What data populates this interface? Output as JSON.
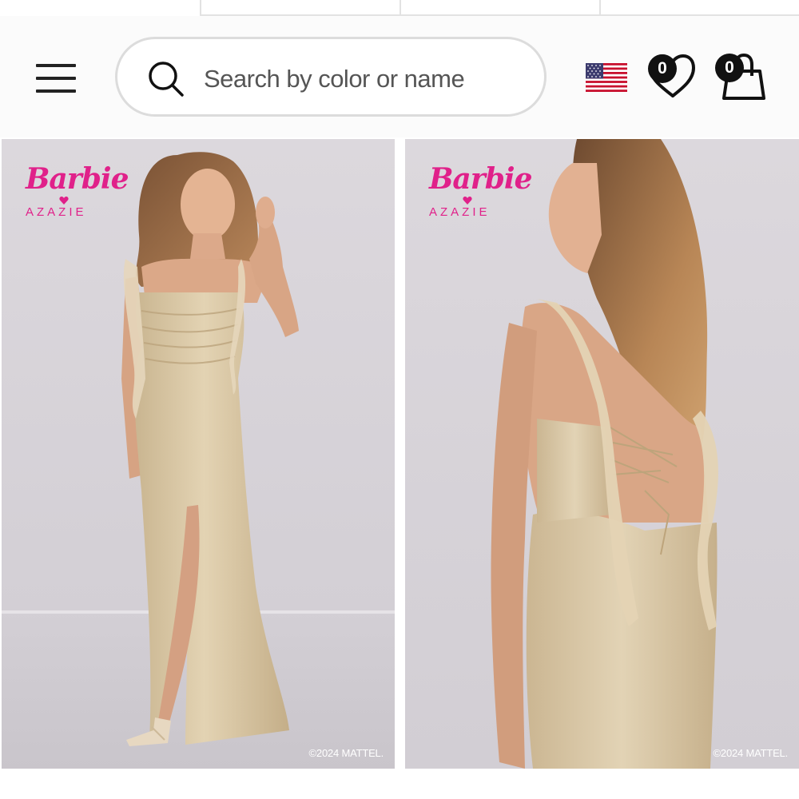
{
  "search": {
    "placeholder": "Search by color or name"
  },
  "header": {
    "flag_icon": "us-flag-icon",
    "wishlist_count": "0",
    "bag_count": "0"
  },
  "products": [
    {
      "brand_name": "Barbie",
      "brand_partner": "AZAZIE",
      "copyright": "©2024 MATTEL."
    },
    {
      "brand_name": "Barbie",
      "brand_partner": "AZAZIE",
      "copyright": "©2024 MATTEL."
    }
  ],
  "colors": {
    "brand_pink": "#e0218a",
    "badge": "#111111",
    "dress_champagne": "#dcc9a6",
    "backdrop": "#d7d3d8"
  }
}
